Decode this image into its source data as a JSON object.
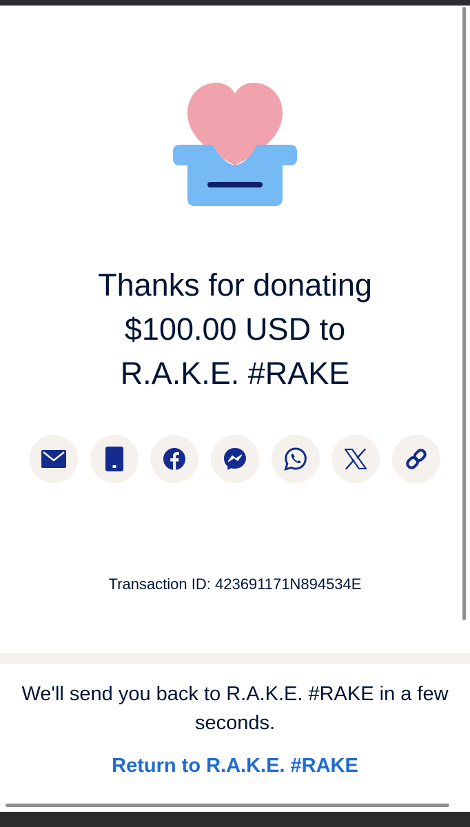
{
  "headline": {
    "line1": "Thanks for donating",
    "line2": "$100.00 USD to",
    "line3": "R.A.K.E. #RAKE"
  },
  "share": {
    "buttons": [
      {
        "icon": "email-icon"
      },
      {
        "icon": "phone-icon"
      },
      {
        "icon": "facebook-icon"
      },
      {
        "icon": "messenger-icon"
      },
      {
        "icon": "whatsapp-icon"
      },
      {
        "icon": "x-icon"
      },
      {
        "icon": "link-icon"
      }
    ]
  },
  "transaction": {
    "text": "Transaction ID: 423691171N894534E"
  },
  "redirect": {
    "message": "We'll send you back to R.A.K.E. #RAKE in a few seconds.",
    "link_label": "Return to R.A.K.E. #RAKE"
  },
  "colors": {
    "heart": "#f0a3ac",
    "box": "#75b9f5",
    "slot": "#0b1f6b",
    "icon": "#142c8e",
    "icon_bg": "#f5f2ee",
    "text": "#001435",
    "link": "#1f6bd3"
  }
}
